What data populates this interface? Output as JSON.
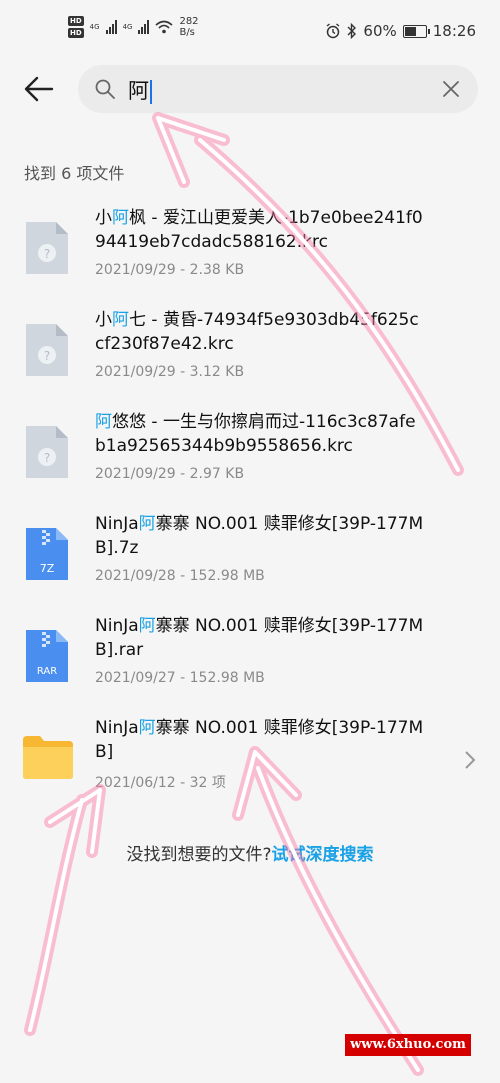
{
  "status_bar": {
    "hd1": "HD",
    "hd2": "HD",
    "net1": "4G",
    "net2": "4G",
    "speed_value": "282",
    "speed_unit": "B/s",
    "battery_text": "60%",
    "battery_level": 0.6,
    "time": "18:26"
  },
  "search": {
    "query": "阿"
  },
  "results": {
    "count_text": "找到 6 项文件",
    "items": [
      {
        "pre": "小",
        "hl": "阿",
        "post": "枫 - 爱江山更爱美人-1b7e0bee241f094419eb7cdadc588162.krc",
        "meta": "2021/09/29 - 2.38 KB",
        "icon": "unknown-file-icon"
      },
      {
        "pre": "小",
        "hl": "阿",
        "post": "七 - 黄昏-74934f5e9303db45f625ccf230f87e42.krc",
        "meta": "2021/09/29 - 3.12 KB",
        "icon": "unknown-file-icon"
      },
      {
        "pre": "",
        "hl": "阿",
        "post": "悠悠 - 一生与你擦肩而过-116c3c87afeb1a92565344b9b9558656.krc",
        "meta": "2021/09/29 - 2.97 KB",
        "icon": "unknown-file-icon"
      },
      {
        "pre": "NinJa",
        "hl": "阿",
        "post": "寨寨 NO.001 赎罪修女[39P-177MB].7z",
        "meta": "2021/09/28 - 152.98 MB",
        "icon": "7z-archive-icon",
        "badge": "7Z"
      },
      {
        "pre": "NinJa",
        "hl": "阿",
        "post": "寨寨 NO.001 赎罪修女[39P-177MB].rar",
        "meta": "2021/09/27 - 152.98 MB",
        "icon": "rar-archive-icon",
        "badge": "RAR"
      },
      {
        "pre": "NinJa",
        "hl": "阿",
        "post": "寨寨 NO.001 赎罪修女[39P-177MB]",
        "meta": "2021/06/12 - 32 项",
        "icon": "folder-icon"
      }
    ]
  },
  "deep_search": {
    "prompt": "没找到想要的文件?",
    "link": "试试深度搜索"
  },
  "watermark": "www.6xhuo.com",
  "colors": {
    "accent": "#1aa1e6",
    "archive": "#4a8ff0",
    "folder": "#fbc02d",
    "annotation": "#ff4f8a"
  }
}
